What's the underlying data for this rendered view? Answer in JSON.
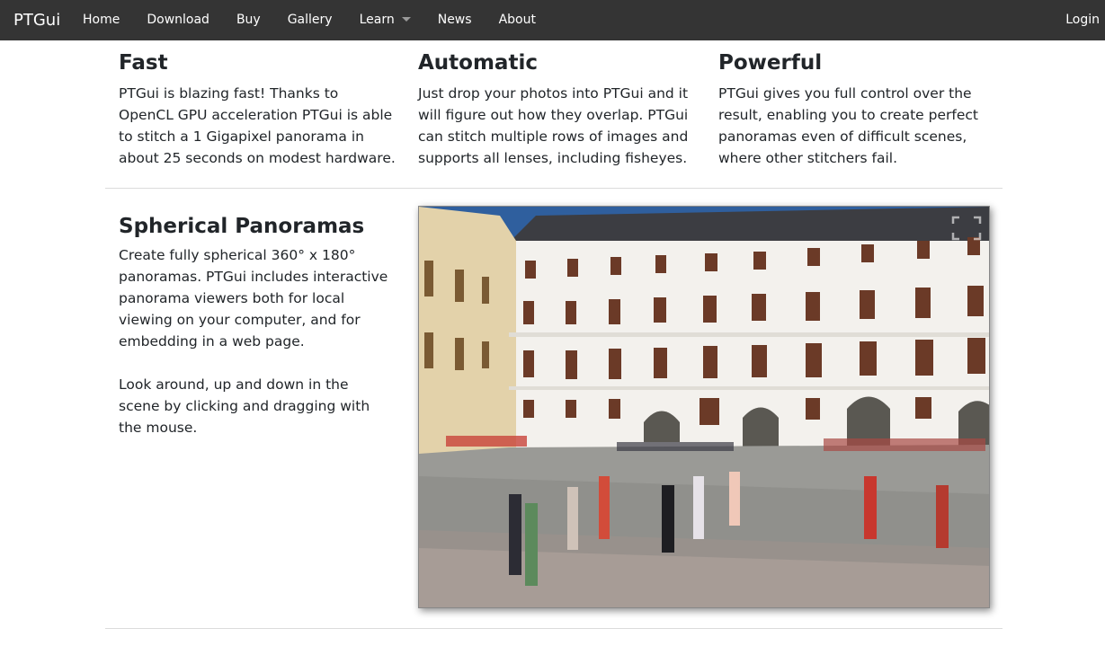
{
  "navbar": {
    "brand": "PTGui",
    "links": [
      "Home",
      "Download",
      "Buy",
      "Gallery",
      "Learn",
      "News",
      "About"
    ],
    "login": "Login"
  },
  "features": [
    {
      "title": "Fast",
      "text": "PTGui is blazing fast! Thanks to OpenCL GPU acceleration PTGui is able to stitch a 1 Gigapixel panorama in about 25 seconds on modest hardware."
    },
    {
      "title": "Automatic",
      "text": "Just drop your photos into PTGui and it will figure out how they overlap. PTGui can stitch multiple rows of images and supports all lenses, including fisheyes."
    },
    {
      "title": "Powerful",
      "text": "PTGui gives you full control over the result, enabling you to create perfect panoramas even of difficult scenes, where other stitchers fail."
    }
  ],
  "spherical": {
    "title": "Spherical Panoramas",
    "paragraph1": "Create fully spherical 360° x 180° panoramas. PTGui includes interactive panorama viewers both for local viewing on your computer, and for embedding in a web page.",
    "paragraph2": "Look around, up and down in the scene by clicking and dragging with the mouse."
  },
  "colors": {
    "navbar_bg": "#343434",
    "sky": "#2f5f9e",
    "roof": "#3c3d42",
    "facade": "#f3f1ed",
    "left_building": "#e3d2aa",
    "pavement": "#9a9a96"
  }
}
